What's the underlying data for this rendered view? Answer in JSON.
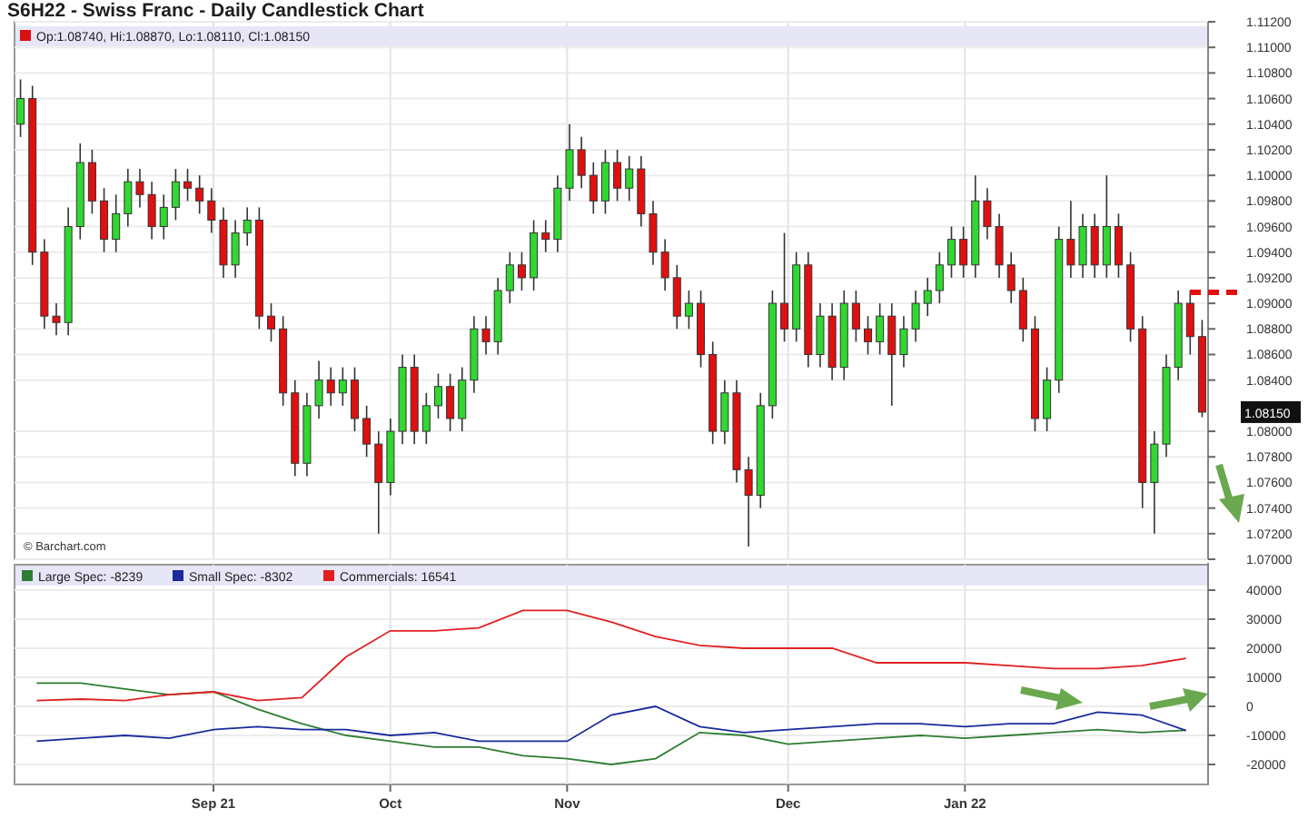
{
  "title": "S6H22 - Swiss Franc - Daily Candlestick Chart",
  "price_chart": {
    "legend": "Op:1.08740, Hi:1.08870, Lo:1.08110, Cl:1.08150",
    "source": "© Barchart.com",
    "last_price": "1.08150",
    "chart_data": {
      "type": "candlestick",
      "grid": true,
      "ylim": [
        1.07,
        1.112
      ],
      "yticks": [
        {
          "value": 1.112,
          "label": "1.11200"
        },
        {
          "value": 1.11,
          "label": "1.11000"
        },
        {
          "value": 1.108,
          "label": "1.10800"
        },
        {
          "value": 1.106,
          "label": "1.10600"
        },
        {
          "value": 1.104,
          "label": "1.10400"
        },
        {
          "value": 1.102,
          "label": "1.10200"
        },
        {
          "value": 1.1,
          "label": "1.10000"
        },
        {
          "value": 1.098,
          "label": "1.09800"
        },
        {
          "value": 1.096,
          "label": "1.09600"
        },
        {
          "value": 1.094,
          "label": "1.09400"
        },
        {
          "value": 1.092,
          "label": "1.09200"
        },
        {
          "value": 1.09,
          "label": "1.09000"
        },
        {
          "value": 1.088,
          "label": "1.08800"
        },
        {
          "value": 1.086,
          "label": "1.08600"
        },
        {
          "value": 1.084,
          "label": "1.08400"
        },
        {
          "value": 1.08,
          "label": "1.08000"
        },
        {
          "value": 1.078,
          "label": "1.07800"
        },
        {
          "value": 1.076,
          "label": "1.07600"
        },
        {
          "value": 1.074,
          "label": "1.07400"
        },
        {
          "value": 1.072,
          "label": "1.07200"
        },
        {
          "value": 1.07,
          "label": "1.07000"
        }
      ],
      "categories": [
        null,
        null,
        null,
        null,
        null,
        null,
        null,
        null,
        null,
        null,
        null,
        null,
        null,
        null,
        null,
        null,
        null,
        null,
        null,
        null,
        null,
        null,
        null,
        null,
        null,
        null,
        null,
        null,
        null,
        null,
        null,
        null,
        null,
        null,
        null,
        null,
        null,
        null,
        null,
        null,
        null,
        null,
        null,
        null,
        null,
        null,
        null,
        null,
        null,
        null,
        null,
        null,
        null,
        null,
        null,
        null,
        null,
        null,
        null,
        null,
        null,
        null,
        null,
        null,
        null,
        null,
        null,
        null,
        null,
        null,
        null,
        null,
        null,
        null,
        null,
        null,
        null,
        null,
        null,
        null,
        null,
        null,
        null,
        null,
        null,
        null,
        null,
        null,
        null,
        null,
        null,
        null,
        null,
        null,
        null,
        null,
        null,
        null,
        null,
        null
      ],
      "ohlc": [
        [
          1.104,
          1.1075,
          1.103,
          1.106
        ],
        [
          1.106,
          1.107,
          1.093,
          1.094
        ],
        [
          1.094,
          1.095,
          1.088,
          1.089
        ],
        [
          1.089,
          1.09,
          1.0875,
          1.0885
        ],
        [
          1.0885,
          1.0975,
          1.0875,
          1.096
        ],
        [
          1.096,
          1.1025,
          1.095,
          1.101
        ],
        [
          1.101,
          1.102,
          1.097,
          1.098
        ],
        [
          1.098,
          1.099,
          1.094,
          1.095
        ],
        [
          1.095,
          1.0985,
          1.094,
          1.097
        ],
        [
          1.097,
          1.1005,
          1.096,
          1.0995
        ],
        [
          1.0995,
          1.1005,
          1.0975,
          1.0985
        ],
        [
          1.0985,
          1.0995,
          1.095,
          1.096
        ],
        [
          1.096,
          1.0985,
          1.095,
          1.0975
        ],
        [
          1.0975,
          1.1005,
          1.0965,
          1.0995
        ],
        [
          1.0995,
          1.1005,
          1.098,
          1.099
        ],
        [
          1.099,
          1.1,
          1.097,
          1.098
        ],
        [
          1.098,
          1.099,
          1.0955,
          1.0965
        ],
        [
          1.0965,
          1.0975,
          1.092,
          1.093
        ],
        [
          1.093,
          1.0965,
          1.092,
          1.0955
        ],
        [
          1.0955,
          1.0975,
          1.0945,
          1.0965
        ],
        [
          1.0965,
          1.0975,
          1.088,
          1.089
        ],
        [
          1.089,
          1.09,
          1.087,
          1.088
        ],
        [
          1.088,
          1.089,
          1.082,
          1.083
        ],
        [
          1.083,
          1.084,
          1.0765,
          1.0775
        ],
        [
          1.0775,
          1.083,
          1.0765,
          1.082
        ],
        [
          1.082,
          1.0855,
          1.081,
          1.084
        ],
        [
          1.084,
          1.085,
          1.082,
          1.083
        ],
        [
          1.083,
          1.085,
          1.082,
          1.084
        ],
        [
          1.084,
          1.085,
          1.08,
          1.081
        ],
        [
          1.081,
          1.082,
          1.078,
          1.079
        ],
        [
          1.079,
          1.08,
          1.072,
          1.076
        ],
        [
          1.076,
          1.081,
          1.075,
          1.08
        ],
        [
          1.08,
          1.086,
          1.079,
          1.085
        ],
        [
          1.085,
          1.086,
          1.079,
          1.08
        ],
        [
          1.08,
          1.083,
          1.079,
          1.082
        ],
        [
          1.082,
          1.0845,
          1.081,
          1.0835
        ],
        [
          1.0835,
          1.0845,
          1.08,
          1.081
        ],
        [
          1.081,
          1.085,
          1.08,
          1.084
        ],
        [
          1.084,
          1.089,
          1.083,
          1.088
        ],
        [
          1.088,
          1.089,
          1.086,
          1.087
        ],
        [
          1.087,
          1.092,
          1.086,
          1.091
        ],
        [
          1.091,
          1.094,
          1.09,
          1.093
        ],
        [
          1.093,
          1.094,
          1.091,
          1.092
        ],
        [
          1.092,
          1.0965,
          1.091,
          1.0955
        ],
        [
          1.0955,
          1.0965,
          1.094,
          1.095
        ],
        [
          1.095,
          1.1,
          1.094,
          1.099
        ],
        [
          1.099,
          1.104,
          1.098,
          1.102
        ],
        [
          1.102,
          1.103,
          1.099,
          1.1
        ],
        [
          1.1,
          1.101,
          1.097,
          1.098
        ],
        [
          1.098,
          1.102,
          1.097,
          1.101
        ],
        [
          1.101,
          1.102,
          1.098,
          1.099
        ],
        [
          1.099,
          1.1015,
          1.098,
          1.1005
        ],
        [
          1.1005,
          1.1015,
          1.096,
          1.097
        ],
        [
          1.097,
          1.098,
          1.093,
          1.094
        ],
        [
          1.094,
          1.095,
          1.091,
          1.092
        ],
        [
          1.092,
          1.093,
          1.088,
          1.089
        ],
        [
          1.089,
          1.091,
          1.088,
          1.09
        ],
        [
          1.09,
          1.091,
          1.085,
          1.086
        ],
        [
          1.086,
          1.087,
          1.079,
          1.08
        ],
        [
          1.08,
          1.084,
          1.079,
          1.083
        ],
        [
          1.083,
          1.084,
          1.076,
          1.077
        ],
        [
          1.077,
          1.078,
          1.071,
          1.075
        ],
        [
          1.075,
          1.083,
          1.074,
          1.082
        ],
        [
          1.082,
          1.091,
          1.081,
          1.09
        ],
        [
          1.09,
          1.0955,
          1.087,
          1.088
        ],
        [
          1.088,
          1.094,
          1.087,
          1.093
        ],
        [
          1.093,
          1.094,
          1.085,
          1.086
        ],
        [
          1.086,
          1.09,
          1.085,
          1.089
        ],
        [
          1.089,
          1.09,
          1.084,
          1.085
        ],
        [
          1.085,
          1.091,
          1.084,
          1.09
        ],
        [
          1.09,
          1.091,
          1.087,
          1.088
        ],
        [
          1.088,
          1.089,
          1.086,
          1.087
        ],
        [
          1.087,
          1.09,
          1.086,
          1.089
        ],
        [
          1.089,
          1.09,
          1.082,
          1.086
        ],
        [
          1.086,
          1.089,
          1.085,
          1.088
        ],
        [
          1.088,
          1.091,
          1.087,
          1.09
        ],
        [
          1.09,
          1.092,
          1.089,
          1.091
        ],
        [
          1.091,
          1.094,
          1.09,
          1.093
        ],
        [
          1.093,
          1.096,
          1.092,
          1.095
        ],
        [
          1.095,
          1.096,
          1.092,
          1.093
        ],
        [
          1.093,
          1.1,
          1.092,
          1.098
        ],
        [
          1.098,
          1.099,
          1.095,
          1.096
        ],
        [
          1.096,
          1.097,
          1.092,
          1.093
        ],
        [
          1.093,
          1.094,
          1.09,
          1.091
        ],
        [
          1.091,
          1.092,
          1.087,
          1.088
        ],
        [
          1.088,
          1.089,
          1.08,
          1.081
        ],
        [
          1.081,
          1.085,
          1.08,
          1.084
        ],
        [
          1.084,
          1.096,
          1.083,
          1.095
        ],
        [
          1.095,
          1.098,
          1.092,
          1.093
        ],
        [
          1.093,
          1.097,
          1.092,
          1.096
        ],
        [
          1.096,
          1.097,
          1.092,
          1.093
        ],
        [
          1.093,
          1.1,
          1.092,
          1.096
        ],
        [
          1.096,
          1.097,
          1.092,
          1.093
        ],
        [
          1.093,
          1.094,
          1.087,
          1.088
        ],
        [
          1.088,
          1.089,
          1.074,
          1.076
        ],
        [
          1.076,
          1.08,
          1.072,
          1.079
        ],
        [
          1.079,
          1.086,
          1.078,
          1.085
        ],
        [
          1.085,
          1.091,
          1.084,
          1.09
        ],
        [
          1.09,
          1.091,
          1.086,
          1.0874
        ],
        [
          1.0874,
          1.0887,
          1.0811,
          1.0815
        ]
      ]
    }
  },
  "cot_chart": {
    "legend_separator": ": ",
    "legend_readings": [
      "-8239",
      "-8302",
      "16541"
    ],
    "chart_data": {
      "type": "line",
      "grid": true,
      "ylim": [
        -26875,
        48750
      ],
      "categories": [
        null,
        null,
        null,
        null,
        "Sep 21",
        null,
        null,
        null,
        "Oct",
        null,
        null,
        null,
        "Nov",
        null,
        null,
        null,
        null,
        "Dec",
        null,
        null,
        null,
        "Jan 22",
        null,
        null,
        null,
        null,
        null
      ],
      "yticks": [
        {
          "value": 40000,
          "label": "40000"
        },
        {
          "value": 30000,
          "label": "30000"
        },
        {
          "value": 20000,
          "label": "20000"
        },
        {
          "value": 10000,
          "label": "10000"
        },
        {
          "value": 0,
          "label": "0"
        },
        {
          "value": -10000,
          "label": "-10000"
        },
        {
          "value": -20000,
          "label": "-20000"
        }
      ],
      "series": [
        {
          "name": "Large Spec",
          "color": "#2e7d32",
          "values": [
            8000,
            8000,
            6000,
            4000,
            5000,
            -1000,
            -6000,
            -10000,
            -12000,
            -14000,
            -14000,
            -17000,
            -18000,
            -20000,
            -18000,
            -9000,
            -10000,
            -13000,
            -12000,
            -11000,
            -10000,
            -11000,
            -10000,
            -9000,
            -8000,
            -9000,
            -8239
          ]
        },
        {
          "name": "Small Spec",
          "color": "#1a2a9c",
          "values": [
            -12000,
            -11000,
            -10000,
            -11000,
            -8000,
            -7000,
            -8000,
            -8000,
            -10000,
            -9000,
            -12000,
            -12000,
            -12000,
            -3000,
            0,
            -7000,
            -9000,
            -8000,
            -7000,
            -6000,
            -6000,
            -7000,
            -6000,
            -6000,
            -2000,
            -3000,
            -8302
          ]
        },
        {
          "name": "Commercials",
          "color": "#e02020",
          "values": [
            2000,
            2500,
            2000,
            4000,
            5000,
            2000,
            3000,
            17000,
            26000,
            26000,
            27000,
            33000,
            33000,
            29000,
            24000,
            21000,
            20000,
            20000,
            20000,
            15000,
            15000,
            15000,
            14000,
            13000,
            13000,
            14000,
            16541
          ]
        }
      ]
    }
  }
}
